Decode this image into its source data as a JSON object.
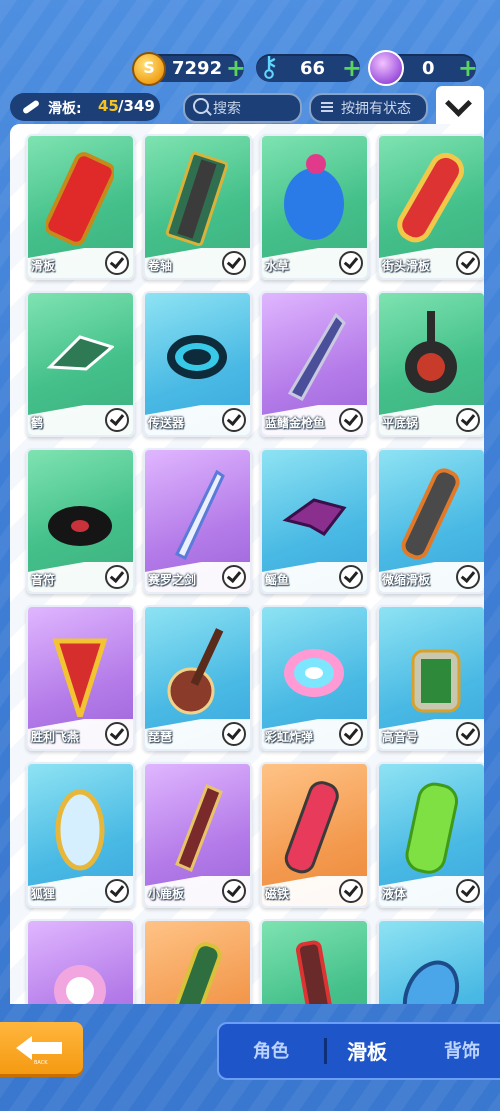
{
  "currency": {
    "coins": {
      "value": "7292",
      "icon": "coin-icon"
    },
    "keys": {
      "value": "66",
      "icon": "key-icon"
    },
    "gems": {
      "value": "0",
      "icon": "gem-icon"
    },
    "add_symbol": "+"
  },
  "filter": {
    "category_label": "滑板:",
    "owned": "45",
    "total": "/349",
    "search_placeholder": "搜索",
    "sort_label": "按拥有状态"
  },
  "items": [
    {
      "name": "滑板",
      "color": "green",
      "owned": true
    },
    {
      "name": "卷轴",
      "color": "green",
      "owned": true
    },
    {
      "name": "水草",
      "color": "green",
      "owned": true
    },
    {
      "name": "街头滑板",
      "color": "green",
      "owned": true
    },
    {
      "name": "鹤",
      "color": "green",
      "owned": true
    },
    {
      "name": "传送器",
      "color": "blue",
      "owned": true
    },
    {
      "name": "蓝鳍金枪鱼",
      "color": "purple",
      "owned": true
    },
    {
      "name": "平底锅",
      "color": "green",
      "owned": true
    },
    {
      "name": "音符",
      "color": "green",
      "owned": true
    },
    {
      "name": "赛罗之剑",
      "color": "purple",
      "owned": true
    },
    {
      "name": "鳐鱼",
      "color": "blue",
      "owned": true
    },
    {
      "name": "微缩滑板",
      "color": "blue",
      "owned": true
    },
    {
      "name": "胜利飞燕",
      "color": "purple",
      "owned": true
    },
    {
      "name": "琵琶",
      "color": "blue",
      "owned": true
    },
    {
      "name": "彩虹炸弹",
      "color": "blue",
      "owned": true
    },
    {
      "name": "高音号",
      "color": "blue",
      "owned": true
    },
    {
      "name": "狐狸",
      "color": "blue",
      "owned": true
    },
    {
      "name": "小鹿板",
      "color": "purple",
      "owned": true
    },
    {
      "name": "磁铁",
      "color": "orange",
      "owned": true
    },
    {
      "name": "液体",
      "color": "blue",
      "owned": true
    },
    {
      "name": "",
      "color": "purple",
      "owned": false
    },
    {
      "name": "",
      "color": "orange",
      "owned": false
    },
    {
      "name": "",
      "color": "green",
      "owned": false
    },
    {
      "name": "",
      "color": "blue",
      "owned": false
    }
  ],
  "bottom": {
    "back_caption": "BACK",
    "tabs": [
      {
        "label": "角色",
        "active": false
      },
      {
        "label": "滑板",
        "active": true
      },
      {
        "label": "背饰",
        "active": false
      }
    ]
  }
}
